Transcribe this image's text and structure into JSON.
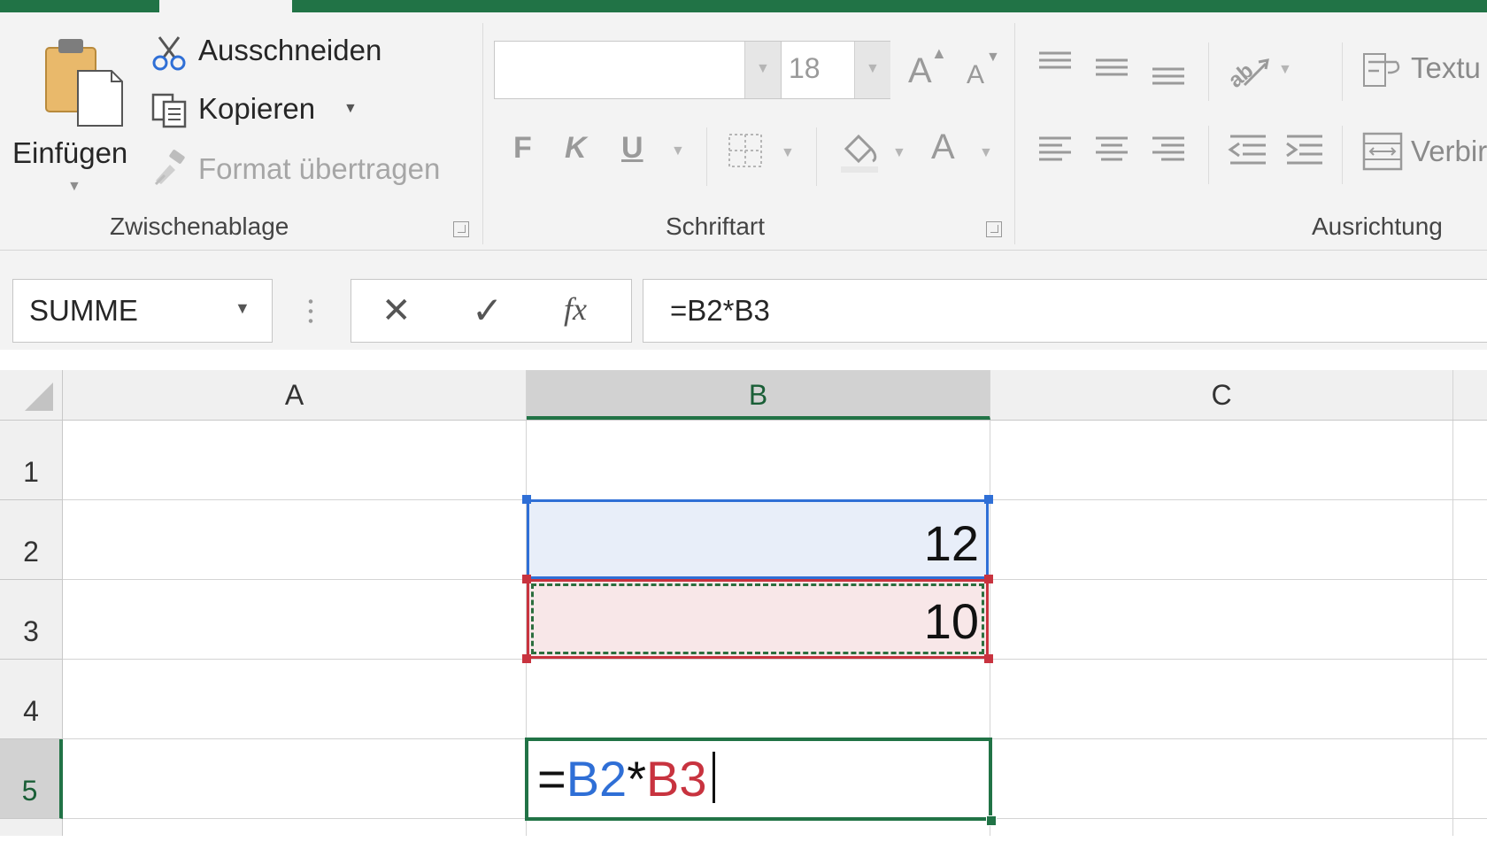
{
  "ribbon": {
    "clipboard": {
      "paste_label": "Einfügen",
      "cut_label": "Ausschneiden",
      "copy_label": "Kopieren",
      "format_painter_label": "Format übertragen",
      "group_label": "Zwischenablage"
    },
    "font": {
      "font_name": "",
      "font_size": "18",
      "bold_label": "F",
      "italic_label": "K",
      "underline_label": "U",
      "grow_label": "A",
      "shrink_label": "A",
      "font_color_label": "A",
      "group_label": "Schriftart"
    },
    "alignment": {
      "wrap_text_label": "Textu",
      "merge_label": "Verbir",
      "group_label": "Ausrichtung"
    }
  },
  "formula_bar": {
    "name_box": "SUMME",
    "cancel_symbol": "✕",
    "enter_symbol": "✓",
    "fx_label": "fx",
    "formula": "=B2*B3"
  },
  "grid": {
    "columns": [
      "A",
      "B",
      "C"
    ],
    "rows": [
      "1",
      "2",
      "3",
      "4",
      "5"
    ],
    "cells": {
      "B2": "12",
      "B3": "10"
    },
    "editing_cell": {
      "eq": "=",
      "ref1": "B2",
      "op": "*",
      "ref2": "B3"
    }
  },
  "colors": {
    "accent_green": "#217346",
    "ref1_blue": "#2f6fd6",
    "ref2_red": "#c8333f",
    "ref1_fill": "#e8eef9",
    "ref2_fill": "#f8e7e8"
  }
}
